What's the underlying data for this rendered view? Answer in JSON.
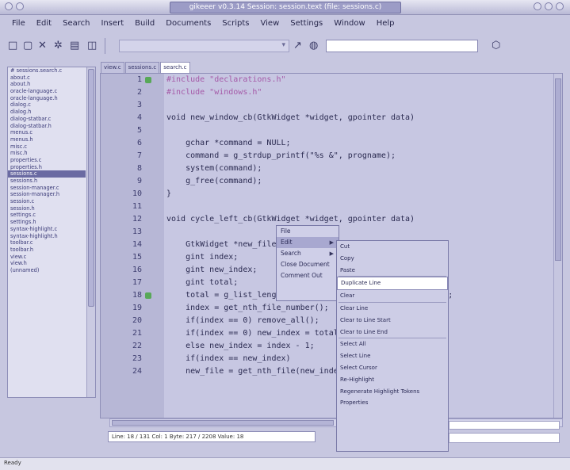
{
  "window": {
    "title": "gikeeer v0.3.14 Session: session.text (file: sessions.c)"
  },
  "menu": [
    "File",
    "Edit",
    "Search",
    "Insert",
    "Build",
    "Documents",
    "Scripts",
    "View",
    "Settings",
    "Window",
    "Help"
  ],
  "toolbar": {
    "icons": [
      "new-file-icon",
      "open-folder-icon",
      "close-icon",
      "settings-icon",
      "copy-icon",
      "save-icon",
      "arrow-icon",
      "stop-icon",
      "search-go-icon"
    ],
    "glyphs": [
      "□",
      "▢",
      "✕",
      "✲",
      "▤",
      "◫",
      "↗",
      "◍",
      "⬡"
    ]
  },
  "sidebar": {
    "files": [
      "# sessions.search.c",
      "about.c",
      "about.h",
      "oracle-language.c",
      "oracle-language.h",
      "dialog.c",
      "dialog.h",
      "dialog-statbar.c",
      "dialog-statbar.h",
      "menus.c",
      "menus.h",
      "misc.c",
      "misc.h",
      "properties.c",
      "properties.h",
      "sessions.c",
      "sessions.h",
      "session-manager.c",
      "session-manager.h",
      "session.c",
      "session.h",
      "settings.c",
      "settings.h",
      "syntax-highlight.c",
      "syntax-highlight.h",
      "toolbar.c",
      "toolbar.h",
      "view.c",
      "view.h",
      "(unnamed)"
    ],
    "selected_index": 15
  },
  "tabs": [
    "view.c",
    "sessions.c",
    "search.c"
  ],
  "active_tab": 2,
  "editor": {
    "lines": [
      {
        "num": "1",
        "text": "#include \"declarations.h\"",
        "fold": true,
        "color": "#a55aa8"
      },
      {
        "num": "2",
        "text": "#include \"windows.h\"",
        "fold": false,
        "color": "#a55aa8"
      },
      {
        "num": "3",
        "text": "",
        "fold": false
      },
      {
        "num": "4",
        "text": "void new_window_cb(GtkWidget *widget, gpointer data)",
        "fold": false
      },
      {
        "num": "5",
        "text": "",
        "fold": false
      },
      {
        "num": "6",
        "text": "    gchar *command = NULL;",
        "fold": false
      },
      {
        "num": "7",
        "text": "    command = g_strdup_printf(\"%s &\", progname);",
        "fold": false
      },
      {
        "num": "8",
        "text": "    system(command);",
        "fold": false
      },
      {
        "num": "9",
        "text": "    g_free(command);",
        "fold": false
      },
      {
        "num": "10",
        "text": "}",
        "fold": false
      },
      {
        "num": "11",
        "text": "",
        "fold": false
      },
      {
        "num": "12",
        "text": "void cycle_left_cb(GtkWidget *widget, gpointer data)",
        "fold": false
      },
      {
        "num": "13",
        "text": "",
        "fold": false
      },
      {
        "num": "14",
        "text": "    GtkWidget *new_file;",
        "fold": false
      },
      {
        "num": "15",
        "text": "    gint index;",
        "fold": false
      },
      {
        "num": "16",
        "text": "    gint new_index;",
        "fold": false
      },
      {
        "num": "17",
        "text": "    gint total;",
        "fold": false
      },
      {
        "num": "18",
        "text": "    total = g_list_length(gtk_container_get_children(book));",
        "fold": true
      },
      {
        "num": "19",
        "text": "    index = get_nth_file_number();",
        "fold": false
      },
      {
        "num": "20",
        "text": "    if(index == 0) remove_all();",
        "fold": false
      },
      {
        "num": "21",
        "text": "    if(index == 0) new_index = total;",
        "fold": false
      },
      {
        "num": "22",
        "text": "    else new_index = index - 1;",
        "fold": false
      },
      {
        "num": "23",
        "text": "    if(index == new_index)",
        "fold": false
      },
      {
        "num": "24",
        "text": "    new_file = get_nth_file(new_index);",
        "fold": false
      }
    ]
  },
  "context_menu": {
    "items": [
      {
        "label": "File",
        "submenu": false
      },
      {
        "label": "Edit",
        "submenu": true
      },
      {
        "label": "Search",
        "submenu": true
      },
      {
        "label": "Close Document",
        "submenu": false
      },
      {
        "label": "Comment Out",
        "submenu": false
      }
    ],
    "highlighted": 1
  },
  "submenu": {
    "items": [
      "Cut",
      "Copy",
      "Paste",
      "Duplicate Line",
      "Clear",
      "Clear Line",
      "Clear to Line Start",
      "Clear to Line End",
      "Select All",
      "Select Line",
      "Select Cursor",
      "Re-Highlight",
      "Regenerate Highlight Tokens",
      "Properties"
    ],
    "highlighted": 3,
    "separators_after": [
      2,
      4,
      7
    ]
  },
  "editor_status": "Line: 18 / 131  Col: 1  Byte: 217 / 2208  Value: 18",
  "statusbar": "Ready"
}
